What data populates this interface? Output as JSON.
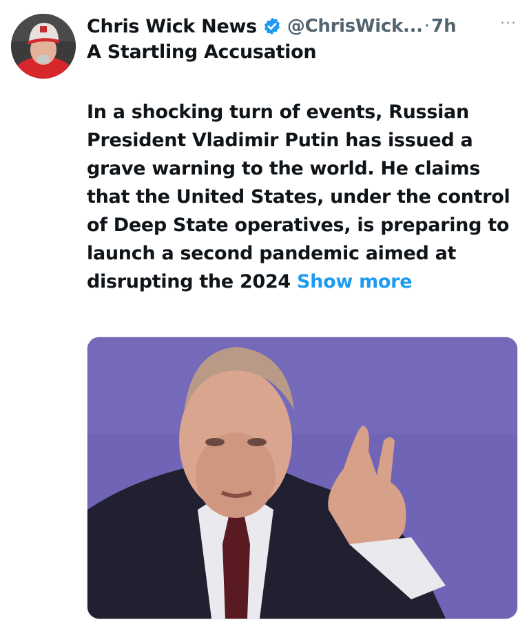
{
  "tweet": {
    "author_name": "Chris Wick News",
    "handle": "@ChrisWick...",
    "separator": "·",
    "time": "7h",
    "more_label": "···",
    "headline": "A Startling Accusation",
    "body": "In a shocking turn of events, Russian President Vladimir Putin has issued a grave warning to the world. He claims that the United States, under the control of Deep State operatives, is preparing to launch a second pandemic aimed at disrupting the 2024",
    "show_more": "Show more"
  },
  "icons": {
    "verified": "verified-badge-icon",
    "more": "more-options-icon"
  },
  "colors": {
    "link": "#1d9bf0",
    "secondary_text": "#536471",
    "media_background": "#6f64b5"
  }
}
